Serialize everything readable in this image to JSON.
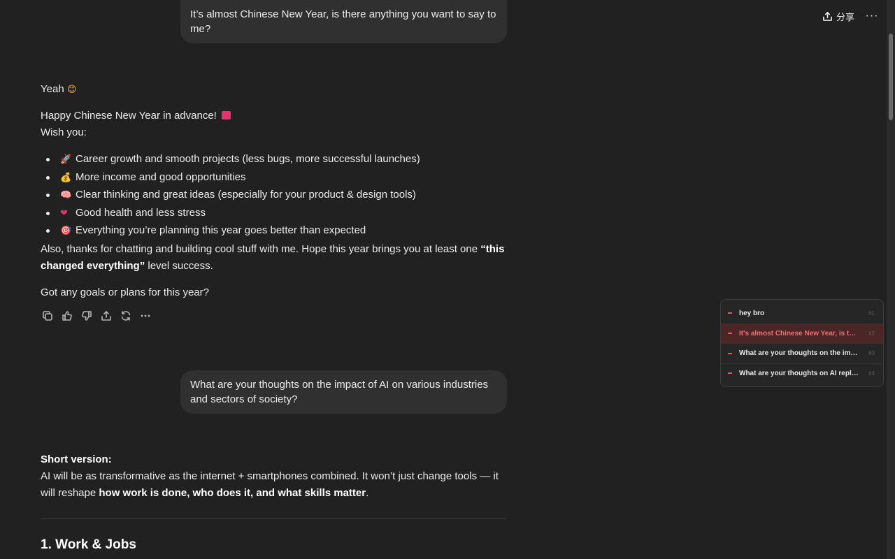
{
  "topbar": {
    "share_label": "分享",
    "more_label": "···"
  },
  "messages": {
    "user1": "It’s almost Chinese New Year, is there anything you want to say to me?",
    "assistant1": {
      "line1": "Yeah",
      "line1_emoji": "😊",
      "line2": "Happy Chinese New Year in advance!",
      "line2_emoji": "🧧",
      "line3": "Wish you:",
      "bullets": [
        {
          "emoji": "🚀",
          "text": "Career growth and smooth projects (less bugs, more successful launches)"
        },
        {
          "emoji": "💰",
          "text": "More income and good opportunities"
        },
        {
          "emoji": "🧠",
          "text": "Clear thinking and great ideas (especially for your product & design tools)"
        },
        {
          "emoji": "❤",
          "text": "Good health and less stress"
        },
        {
          "emoji": "🎯",
          "text": "Everything you’re planning this year goes better than expected"
        }
      ],
      "thanks_pre": "Also, thanks for chatting and building cool stuff with me. Hope this year brings you at least one ",
      "thanks_bold": "“this changed everything”",
      "thanks_post": " level success.",
      "question": "Got any goals or plans for this year?"
    },
    "user2": "What are your thoughts on the impact of AI on various industries and sectors of society?",
    "assistant2": {
      "short_label": "Short version:",
      "short_pre": "AI will be as transformative as the internet + smartphones combined. It won’t just change tools — it will reshape ",
      "short_bold": "how work is done, who does it, and what skills matter",
      "short_post": ".",
      "heading": "1. Work & Jobs"
    }
  },
  "outline": {
    "items": [
      {
        "label": "hey bro",
        "num": "#1",
        "active": false
      },
      {
        "label": "It's almost Chinese New Year, is there anything you want to say to me?",
        "num": "#2",
        "active": true
      },
      {
        "label": "What are your thoughts on the impact of AI on various industries",
        "num": "#3",
        "active": false
      },
      {
        "label": "What are your thoughts on AI replacing jobs",
        "num": "#4",
        "active": false
      }
    ]
  },
  "colors": {
    "background": "#212121",
    "bubble": "#303030",
    "accent": "#e05a5a"
  }
}
